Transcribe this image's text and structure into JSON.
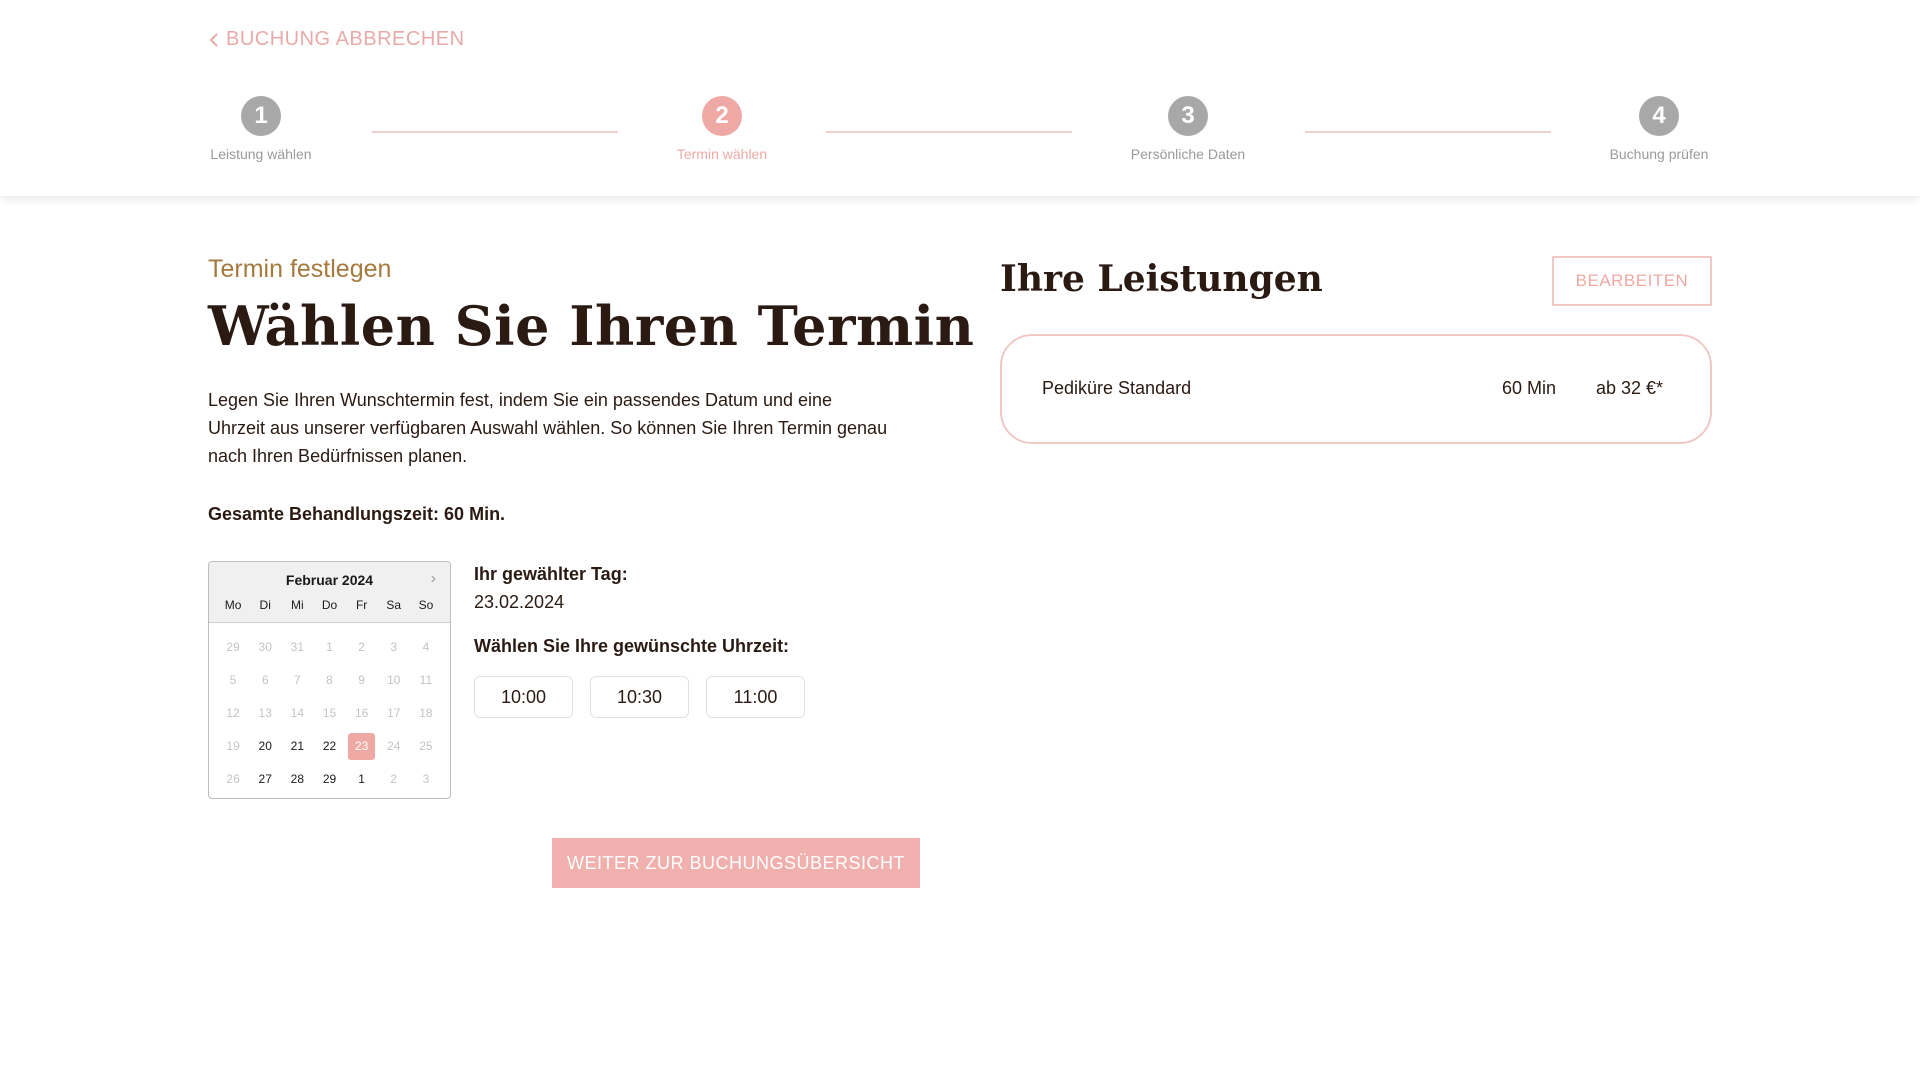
{
  "header": {
    "cancel_label": "BUCHUNG ABBRECHEN",
    "steps": [
      {
        "number": "1",
        "label": "Leistung wählen"
      },
      {
        "number": "2",
        "label": "Termin wählen"
      },
      {
        "number": "3",
        "label": "Persönliche Daten"
      },
      {
        "number": "4",
        "label": "Buchung prüfen"
      }
    ],
    "active_step": 2
  },
  "main": {
    "subtitle": "Termin festlegen",
    "title": "Wählen Sie Ihren Termin",
    "intro": "Legen Sie Ihren Wunschtermin fest, indem Sie ein passendes Datum und eine Uhrzeit aus unserer verfügbaren Auswahl wählen. So können Sie Ihren Termin genau nach Ihren Bedürfnissen planen.",
    "total_time": "Gesamte Behandlungszeit: 60 Min.",
    "calendar": {
      "month": "Februar 2024",
      "weekdays": [
        "Mo",
        "Di",
        "Mi",
        "Do",
        "Fr",
        "Sa",
        "So"
      ],
      "weeks": [
        [
          {
            "d": "29",
            "m": true
          },
          {
            "d": "30",
            "m": true
          },
          {
            "d": "31",
            "m": true
          },
          {
            "d": "1",
            "m": true
          },
          {
            "d": "2",
            "m": true
          },
          {
            "d": "3",
            "m": true
          },
          {
            "d": "4",
            "m": true
          }
        ],
        [
          {
            "d": "5",
            "m": true
          },
          {
            "d": "6",
            "m": true
          },
          {
            "d": "7",
            "m": true
          },
          {
            "d": "8",
            "m": true
          },
          {
            "d": "9",
            "m": true
          },
          {
            "d": "10",
            "m": true
          },
          {
            "d": "11",
            "m": true
          }
        ],
        [
          {
            "d": "12",
            "m": true
          },
          {
            "d": "13",
            "m": true
          },
          {
            "d": "14",
            "m": true
          },
          {
            "d": "15",
            "m": true
          },
          {
            "d": "16",
            "m": true
          },
          {
            "d": "17",
            "m": true
          },
          {
            "d": "18",
            "m": true
          }
        ],
        [
          {
            "d": "19",
            "m": true
          },
          {
            "d": "20",
            "m": false
          },
          {
            "d": "21",
            "m": false
          },
          {
            "d": "22",
            "m": false
          },
          {
            "d": "23",
            "m": false,
            "s": true
          },
          {
            "d": "24",
            "m": true
          },
          {
            "d": "25",
            "m": true
          }
        ],
        [
          {
            "d": "26",
            "m": true
          },
          {
            "d": "27",
            "m": false
          },
          {
            "d": "28",
            "m": false
          },
          {
            "d": "29",
            "m": false
          },
          {
            "d": "1",
            "m": false
          },
          {
            "d": "2",
            "m": true
          },
          {
            "d": "3",
            "m": true
          }
        ]
      ]
    },
    "chosen_day_label": "Ihr gewählter Tag:",
    "chosen_day_value": "23.02.2024",
    "time_label": "Wählen Sie Ihre gewünschte Uhrzeit:",
    "time_slots": [
      "10:00",
      "10:30",
      "11:00"
    ],
    "continue_label": "WEITER ZUR BUCHUNGSÜBERSICHT"
  },
  "services": {
    "title": "Ihre Leistungen",
    "edit_label": "BEARBEITEN",
    "items": [
      {
        "name": "Pediküre Standard",
        "duration": "60 Min",
        "price": "ab 32 €*"
      }
    ]
  },
  "colors": {
    "accent": "#eea9a5",
    "accent_border": "#f2c8c5",
    "subtitle": "#a6793f",
    "inactive_step": "#a8a8a8",
    "text": "#2a1a12"
  }
}
